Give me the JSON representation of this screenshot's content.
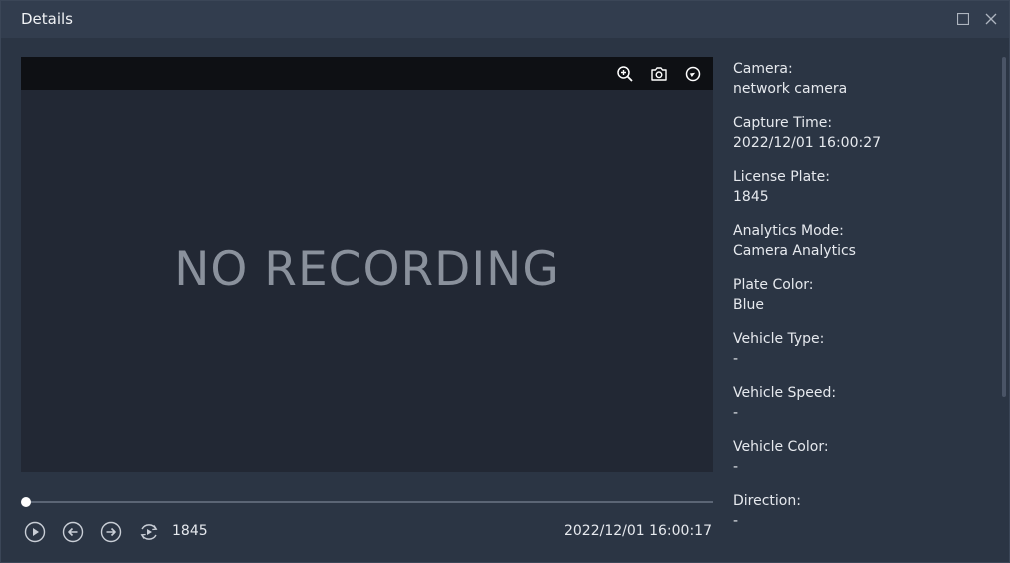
{
  "window": {
    "title": "Details"
  },
  "video": {
    "no_recording_text": "NO RECORDING",
    "toolbar_icons": [
      "zoom-in-icon",
      "camera-icon",
      "record-icon"
    ]
  },
  "playback": {
    "progress": 0,
    "plate": "1845",
    "time": "2022/12/01 16:00:17",
    "control_icons": [
      "play-icon",
      "arrow-left-icon",
      "arrow-right-icon",
      "loop-icon"
    ]
  },
  "details": [
    {
      "label": "Camera:",
      "value": "network camera"
    },
    {
      "label": "Capture Time:",
      "value": "2022/12/01 16:00:27"
    },
    {
      "label": "License Plate:",
      "value": "1845"
    },
    {
      "label": "Analytics Mode:",
      "value": "Camera Analytics"
    },
    {
      "label": "Plate Color:",
      "value": "Blue"
    },
    {
      "label": "Vehicle Type:",
      "value": "-"
    },
    {
      "label": "Vehicle Speed:",
      "value": "-"
    },
    {
      "label": "Vehicle Color:",
      "value": "-"
    },
    {
      "label": "Direction:",
      "value": "-"
    }
  ],
  "colors": {
    "window_bg": "#2b3544",
    "titlebar_bg": "#323d4e",
    "video_bg": "#222834",
    "video_toolbar_bg": "#0e1014",
    "text": "#e6e9ee",
    "muted_text": "#8a919c"
  }
}
